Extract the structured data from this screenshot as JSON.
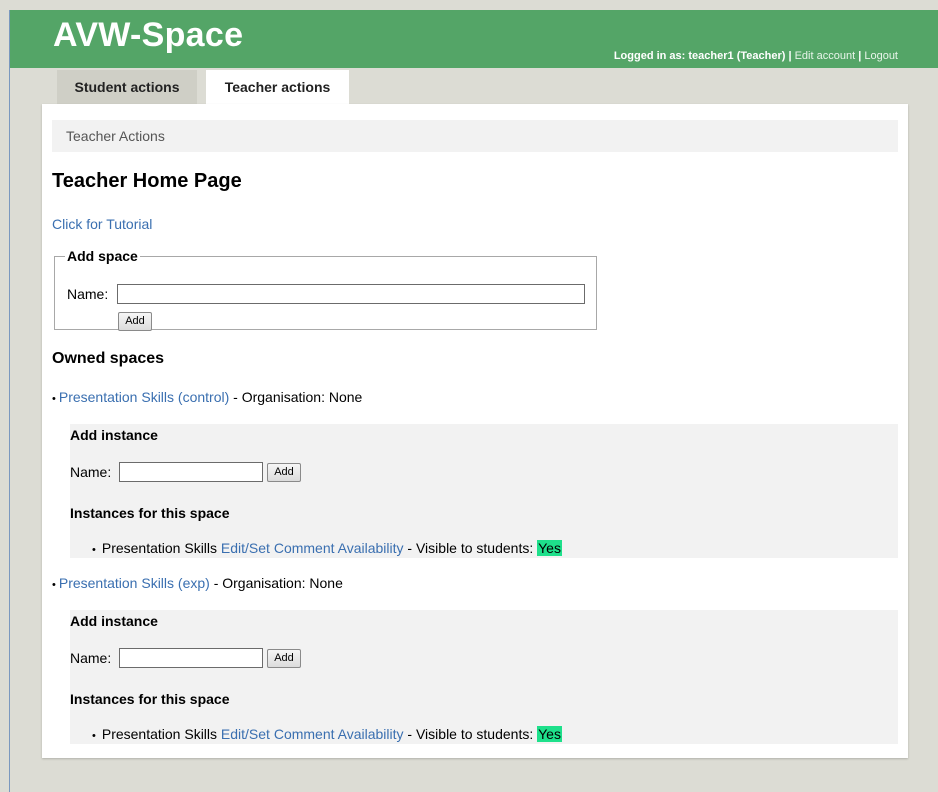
{
  "header": {
    "app_title": "AVW-Space",
    "logged_in_text": "Logged in as: teacher1 (Teacher) | ",
    "edit_account": "Edit account",
    "separator": " | ",
    "logout": "Logout",
    "bg_color": "#54a567"
  },
  "tabs": [
    {
      "label": "Student actions",
      "active": false
    },
    {
      "label": "Teacher actions",
      "active": true
    }
  ],
  "breadcrumb": "Teacher Actions",
  "page_title": "Teacher Home Page",
  "tutorial_link": "Click for Tutorial",
  "add_space": {
    "legend": "Add space",
    "name_label": "Name:",
    "name_value": "",
    "button": "Add"
  },
  "owned_spaces_title": "Owned spaces",
  "spaces": [
    {
      "bullet": "•",
      "name": "Presentation Skills (control)",
      "org_text": " - Organisation: None",
      "add_instance_title": "Add instance",
      "name_label": "Name:",
      "name_value": "",
      "button": "Add",
      "instances_title": "Instances for this space",
      "instances": [
        {
          "bullet": "•",
          "name": "Presentation Skills",
          "edit_link": "Edit/Set Comment Availability",
          "visible_text": " - Visible to students: ",
          "visible_value": "Yes"
        }
      ]
    },
    {
      "bullet": "•",
      "name": "Presentation Skills (exp)",
      "org_text": " - Organisation: None",
      "add_instance_title": "Add instance",
      "name_label": "Name:",
      "name_value": "",
      "button": "Add",
      "instances_title": "Instances for this space",
      "instances": [
        {
          "bullet": "•",
          "name": "Presentation Skills",
          "edit_link": "Edit/Set Comment Availability",
          "visible_text": " - Visible to students: ",
          "visible_value": "Yes"
        }
      ]
    }
  ],
  "colors": {
    "link": "#3a6fb0",
    "yes_highlight": "#1ee08b"
  }
}
